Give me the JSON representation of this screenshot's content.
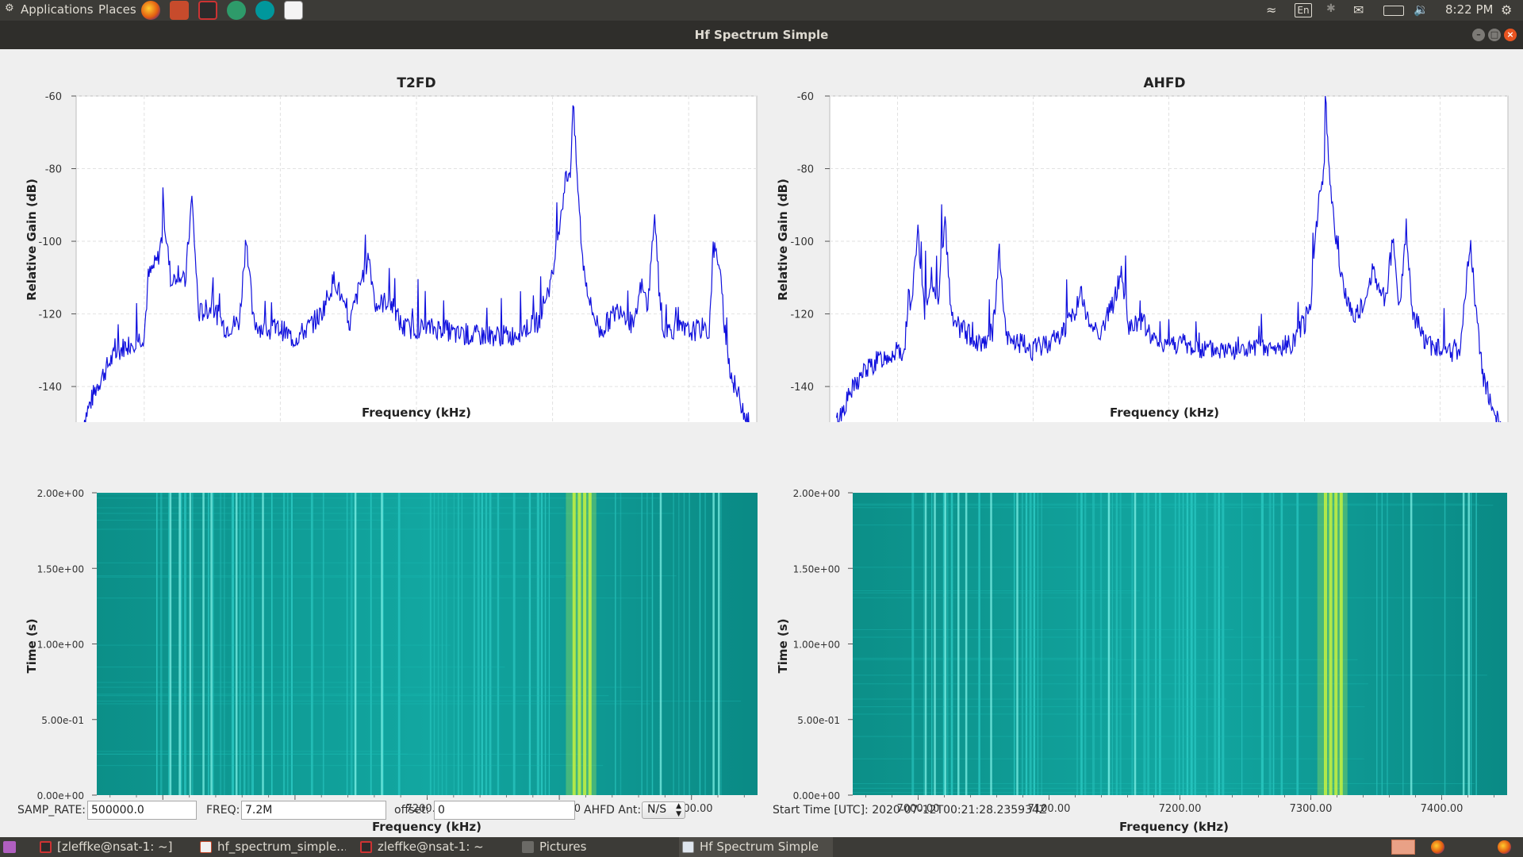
{
  "top_panel": {
    "applications": "Applications",
    "places": "Places",
    "keyboard_layout": "En",
    "clock": "8:22 PM"
  },
  "window": {
    "title": "Hf Spectrum Simple"
  },
  "plots": {
    "left": {
      "title": "T2FD"
    },
    "right": {
      "title": "AHFD"
    },
    "freq_axis_label": "Frequency (kHz)",
    "gain_axis_label": "Relative Gain (dB)",
    "time_axis_label": "Time (s)",
    "freq_ticks": [
      "7000.00",
      "7100.00",
      "7200.00",
      "7300.00",
      "7400.00"
    ],
    "gain_ticks": [
      "-60",
      "-80",
      "-100",
      "-120",
      "-140"
    ],
    "time_ticks": [
      "2.00e+00",
      "1.50e+00",
      "1.00e+00",
      "5.00e-01",
      "0.00e+00"
    ]
  },
  "controls": {
    "samp_rate_label": "SAMP_RATE:",
    "samp_rate_value": "500000.0",
    "freq_label": "FREQ:",
    "freq_value": "7.2M",
    "offset_label": "offset:",
    "offset_value": "0",
    "ahfd_ant_label": "AHFD Ant:",
    "ahfd_ant_value": "N/S",
    "start_time": "Start Time [UTC]: 2020-07-12T00:21:28.235934Z"
  },
  "taskbar": {
    "items": [
      "[zleffke@nsat-1: ~]",
      "hf_spectrum_simple...",
      "zleffke@nsat-1: ~",
      "Pictures",
      "Hf Spectrum Simple"
    ]
  },
  "chart_data": [
    {
      "type": "line",
      "title": "T2FD",
      "xlabel": "Frequency (kHz)",
      "ylabel": "Relative Gain (dB)",
      "xlim": [
        6950,
        7450
      ],
      "ylim": [
        -152,
        -60
      ],
      "grid": true,
      "series": [
        {
          "x": [
            6955,
            6965,
            6975,
            6985,
            6995,
            7000,
            7003,
            7010,
            7015,
            7020,
            7025,
            7030,
            7035,
            7040,
            7050,
            7060,
            7070,
            7075,
            7080,
            7090,
            7100,
            7110,
            7120,
            7130,
            7140,
            7145,
            7150,
            7160,
            7165,
            7170,
            7180,
            7190,
            7200,
            7210,
            7220,
            7230,
            7240,
            7250,
            7260,
            7270,
            7280,
            7290,
            7295,
            7300,
            7305,
            7310,
            7313,
            7315,
            7318,
            7322,
            7328,
            7335,
            7345,
            7350,
            7360,
            7365,
            7370,
            7375,
            7380,
            7390,
            7400,
            7410,
            7415,
            7418,
            7422,
            7428,
            7432,
            7438,
            7445
          ],
          "y": [
            -150,
            -140,
            -133,
            -129,
            -127,
            -126,
            -110,
            -105,
            -95,
            -112,
            -108,
            -112,
            -88,
            -120,
            -118,
            -124,
            -122,
            -98,
            -122,
            -125,
            -124,
            -127,
            -124,
            -120,
            -110,
            -116,
            -124,
            -110,
            -104,
            -118,
            -116,
            -124,
            -124,
            -124,
            -124,
            -126,
            -126,
            -126,
            -126,
            -126,
            -124,
            -122,
            -115,
            -110,
            -95,
            -82,
            -81,
            -62,
            -82,
            -105,
            -118,
            -125,
            -120,
            -118,
            -124,
            -112,
            -118,
            -92,
            -125,
            -124,
            -125,
            -124,
            -125,
            -102,
            -105,
            -130,
            -138,
            -144,
            -151
          ]
        }
      ]
    },
    {
      "type": "line",
      "title": "AHFD",
      "xlabel": "Frequency (kHz)",
      "ylabel": "Relative Gain (dB)",
      "xlim": [
        6950,
        7450
      ],
      "ylim": [
        -152,
        -60
      ],
      "grid": true,
      "series": [
        {
          "x": [
            6955,
            6965,
            6975,
            6985,
            6995,
            7005,
            7008,
            7010,
            7015,
            7020,
            7025,
            7030,
            7035,
            7040,
            7050,
            7060,
            7070,
            7075,
            7080,
            7090,
            7100,
            7110,
            7120,
            7130,
            7135,
            7140,
            7150,
            7160,
            7165,
            7170,
            7180,
            7190,
            7200,
            7210,
            7220,
            7230,
            7240,
            7250,
            7260,
            7270,
            7280,
            7290,
            7300,
            7305,
            7310,
            7314,
            7316,
            7320,
            7328,
            7335,
            7345,
            7350,
            7360,
            7365,
            7370,
            7375,
            7380,
            7390,
            7400,
            7410,
            7415,
            7418,
            7422,
            7428,
            7432,
            7438,
            7445
          ],
          "y": [
            -150,
            -142,
            -136,
            -133,
            -131,
            -130,
            -115,
            -118,
            -98,
            -120,
            -110,
            -115,
            -95,
            -122,
            -125,
            -128,
            -126,
            -103,
            -127,
            -128,
            -130,
            -128,
            -126,
            -120,
            -114,
            -122,
            -125,
            -116,
            -108,
            -124,
            -122,
            -128,
            -128,
            -128,
            -130,
            -130,
            -130,
            -130,
            -130,
            -130,
            -130,
            -128,
            -123,
            -115,
            -90,
            -82,
            -65,
            -90,
            -112,
            -120,
            -118,
            -108,
            -116,
            -100,
            -118,
            -98,
            -120,
            -128,
            -130,
            -131,
            -130,
            -118,
            -100,
            -125,
            -138,
            -145,
            -151
          ]
        }
      ]
    },
    {
      "type": "heatmap",
      "title": "T2FD",
      "xlabel": "Frequency (kHz)",
      "ylabel": "Time (s)",
      "xlim": [
        6950,
        7450
      ],
      "ylim": [
        0,
        2
      ],
      "bright_columns_khz": [
        7005,
        7012,
        7020,
        7030,
        7036,
        7055,
        7075,
        7145,
        7165,
        7310,
        7314,
        7318,
        7322,
        7376,
        7416,
        7420
      ]
    },
    {
      "type": "heatmap",
      "title": "AHFD",
      "xlabel": "Frequency (kHz)",
      "ylabel": "Time (s)",
      "xlim": [
        6950,
        7450
      ],
      "ylim": [
        0,
        2
      ],
      "bright_columns_khz": [
        7005,
        7012,
        7020,
        7030,
        7036,
        7055,
        7075,
        7145,
        7165,
        7310,
        7314,
        7318,
        7322,
        7376,
        7416,
        7420
      ]
    }
  ]
}
